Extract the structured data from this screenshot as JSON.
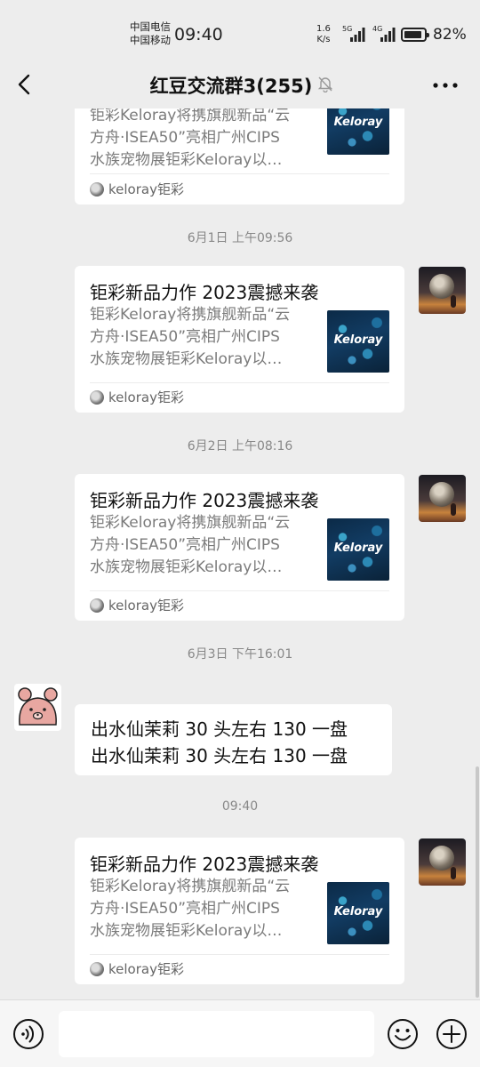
{
  "status_bar": {
    "carrier_1": "中国电信",
    "carrier_2": "中国移动",
    "time": "09:40",
    "net_speed_value": "1.6",
    "net_speed_unit": "K/s",
    "signal_1_label": "5G",
    "signal_2_label": "4G",
    "battery_percent": "82%",
    "battery_level": 0.82
  },
  "nav": {
    "title": "红豆交流群3(255)",
    "back_icon": "back-chevron-icon",
    "mute_icon": "muted-bell-icon",
    "more_icon": "more-dots-icon"
  },
  "messages": {
    "card_0": {
      "desc_line_1": "钜彩Keloray将携旗舰新品“云",
      "desc_line_2": "方舟·ISEA50”亮相广州CIPS",
      "desc_line_3": "水族宠物展钜彩Keloray以…",
      "thumb_text": "Keloray",
      "source": "keloray钜彩"
    },
    "ts_1": "6月1日 上午09:56",
    "card_1": {
      "title": "钜彩新品力作 2023震撼来袭",
      "desc_line_1": "钜彩Keloray将携旗舰新品“云",
      "desc_line_2": "方舟·ISEA50”亮相广州CIPS",
      "desc_line_3": "水族宠物展钜彩Keloray以…",
      "thumb_text": "Keloray",
      "source": "keloray钜彩"
    },
    "ts_2": "6月2日 上午08:16",
    "card_2": {
      "title": "钜彩新品力作 2023震撼来袭",
      "desc_line_1": "钜彩Keloray将携旗舰新品“云",
      "desc_line_2": "方舟·ISEA50”亮相广州CIPS",
      "desc_line_3": "水族宠物展钜彩Keloray以…",
      "thumb_text": "Keloray",
      "source": "keloray钜彩"
    },
    "ts_3": "6月3日 下午16:01",
    "text_msg": {
      "line_1": "出水仙茉莉 30 头左右 130 一盘",
      "line_2": "出水仙茉莉 30 头左右 130 一盘"
    },
    "ts_4": "09:40",
    "card_3": {
      "title": "钜彩新品力作 2023震撼来袭",
      "desc_line_1": "钜彩Keloray将携旗舰新品“云",
      "desc_line_2": "方舟·ISEA50”亮相广州CIPS",
      "desc_line_3": "水族宠物展钜彩Keloray以…",
      "thumb_text": "Keloray",
      "source": "keloray钜彩"
    }
  },
  "input_bar": {
    "voice_icon": "voice-icon",
    "input_value": "",
    "emoji_icon": "emoji-icon",
    "plus_icon": "plus-icon"
  },
  "colors": {
    "background": "#ededed",
    "bubble": "#ffffff",
    "timestamp": "#888888",
    "desc_text": "#7b7b7b"
  }
}
